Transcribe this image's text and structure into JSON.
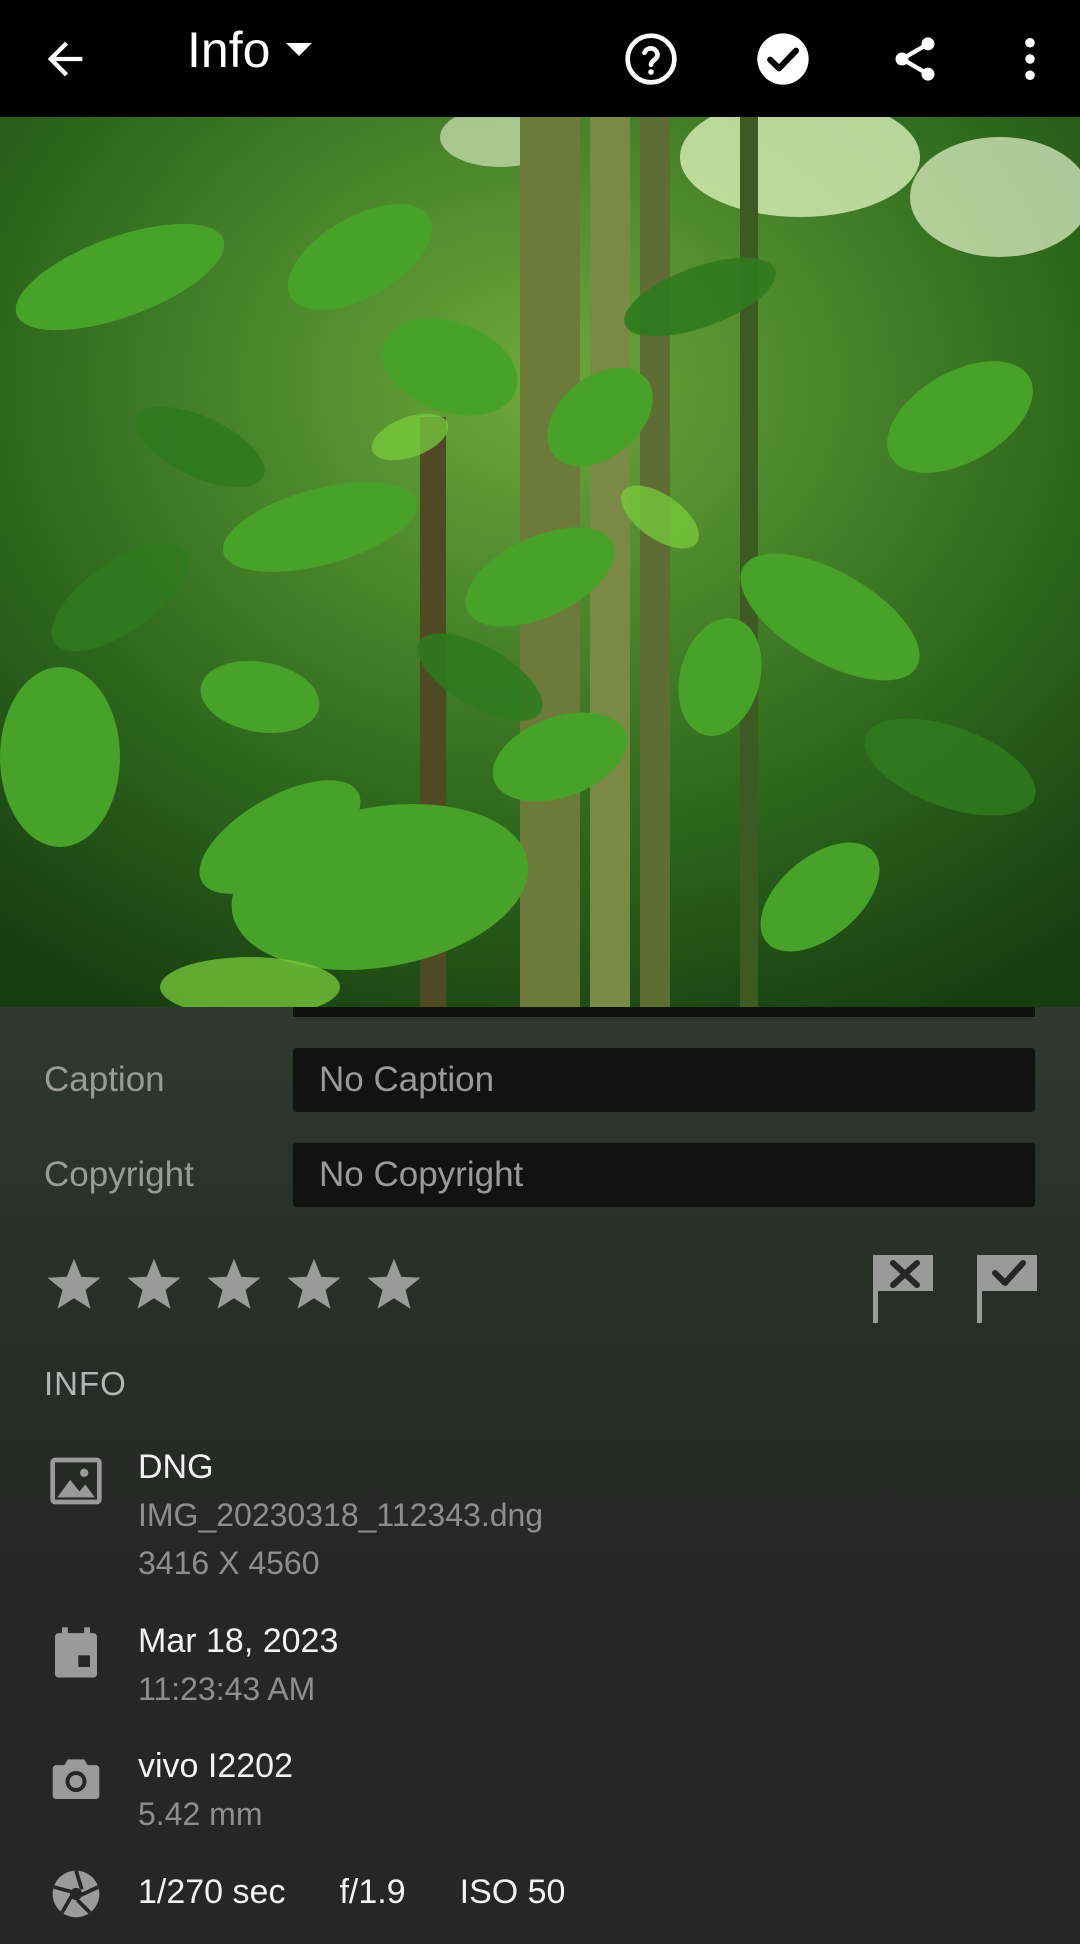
{
  "header": {
    "title": "Info",
    "icons": [
      "back-arrow-icon",
      "dropdown-caret-icon",
      "help-icon",
      "checkmark-icon",
      "share-icon",
      "more-vert-icon"
    ]
  },
  "metadata": {
    "caption_label": "Caption",
    "caption_value": "No Caption",
    "copyright_label": "Copyright",
    "copyright_value": "No Copyright"
  },
  "rating": {
    "value": 0,
    "max": 5
  },
  "info": {
    "section_title": "INFO",
    "file_type": "DNG",
    "file_name": "IMG_20230318_112343.dng",
    "dimensions": "3416 X 4560",
    "date": "Mar 18, 2023",
    "time": "11:23:43 AM",
    "camera": "vivo I2202",
    "focal_length": "5.42 mm",
    "shutter": "1/270 sec",
    "aperture": "f/1.9",
    "iso": "ISO 50"
  },
  "colors": {
    "header_bg": "#000000",
    "panel_bg": "#262626",
    "input_bg": "#121212",
    "icon_gray": "#9a9a9a"
  }
}
